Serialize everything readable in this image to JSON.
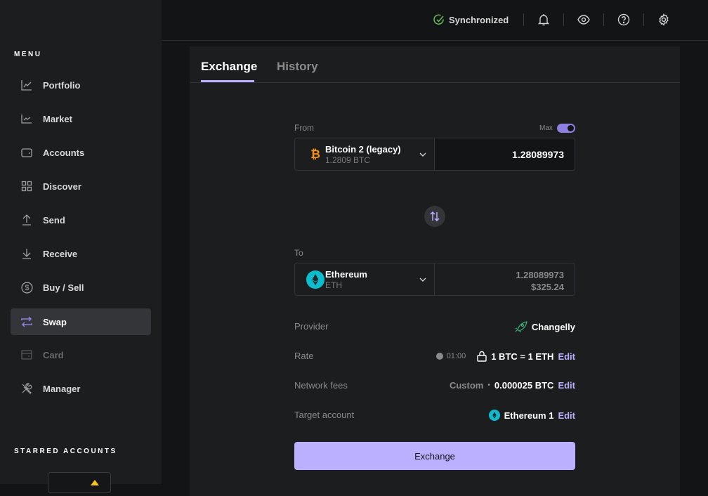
{
  "sidebar": {
    "menu_title": "MENU",
    "items": [
      {
        "label": "Portfolio",
        "icon": "chart-line-icon"
      },
      {
        "label": "Market",
        "icon": "market-chart-icon"
      },
      {
        "label": "Accounts",
        "icon": "wallet-icon"
      },
      {
        "label": "Discover",
        "icon": "grid-icon"
      },
      {
        "label": "Send",
        "icon": "upload-arrow-icon"
      },
      {
        "label": "Receive",
        "icon": "download-arrow-icon"
      },
      {
        "label": "Buy / Sell",
        "icon": "dollar-circle-icon"
      },
      {
        "label": "Swap",
        "icon": "swap-arrows-icon",
        "active": true
      },
      {
        "label": "Card",
        "icon": "card-icon",
        "disabled": true
      },
      {
        "label": "Manager",
        "icon": "tools-icon"
      }
    ],
    "starred_title": "STARRED ACCOUNTS"
  },
  "topbar": {
    "sync_status": "Synchronized",
    "icons": [
      "bell-icon",
      "eye-icon",
      "help-icon",
      "gear-icon"
    ]
  },
  "tabs": [
    {
      "label": "Exchange",
      "active": true
    },
    {
      "label": "History",
      "active": false
    }
  ],
  "from": {
    "label": "From",
    "max_label": "Max",
    "max_enabled": true,
    "coin_name": "Bitcoin 2 (legacy)",
    "coin_balance": "1.2809 BTC",
    "amount": "1.28089973"
  },
  "to": {
    "label": "To",
    "coin_name": "Ethereum",
    "coin_ticker": "ETH",
    "amount": "1.28089973",
    "fiat_value": "$325.24"
  },
  "details": {
    "provider_label": "Provider",
    "provider_value": "Changelly",
    "rate_label": "Rate",
    "rate_timer": "01:00",
    "rate_value": "1 BTC = 1 ETH",
    "fees_label": "Network fees",
    "fees_mode": "Custom",
    "fees_value": "0.000025 BTC",
    "target_label": "Target account",
    "target_value": "Ethereum 1",
    "edit_label": "Edit"
  },
  "exchange_button": "Exchange",
  "colors": {
    "accent": "#bbb0ff",
    "sync_green": "#66be54",
    "btc_orange": "#f7931a",
    "eth_teal": "#0ebdcd",
    "provider_green": "#3fb37a"
  }
}
